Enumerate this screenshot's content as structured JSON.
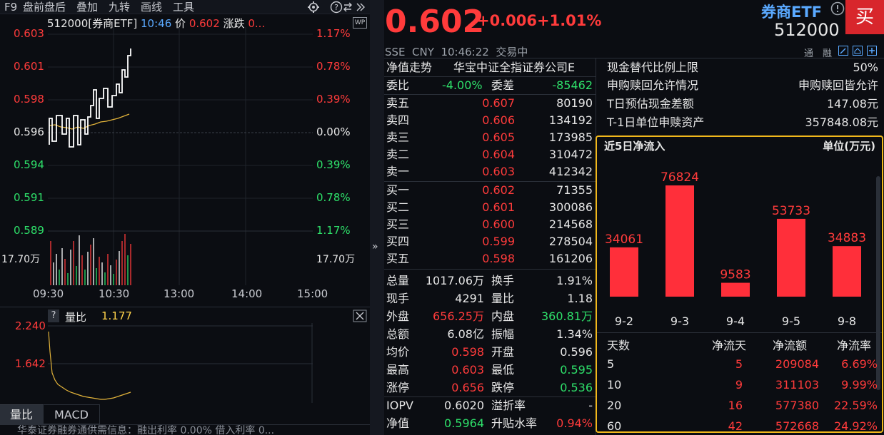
{
  "toolbar": {
    "items": [
      "F9",
      "盘前盘后",
      "叠加",
      "九转",
      "画线",
      "工具"
    ],
    "icons": [
      "gear-icon",
      "help-icon",
      "swap-icon",
      "expand-icon"
    ]
  },
  "chart": {
    "header": {
      "code_name": "512000[券商ETF]",
      "time": "10:46",
      "price_label": "价",
      "price": "0.602",
      "change_label": "涨跌",
      "change_trunc": "0..."
    },
    "wp_badge": "WP",
    "price_levels": [
      "0.603",
      "0.601",
      "0.598",
      "0.596",
      "0.594",
      "0.591",
      "0.589"
    ],
    "pct_levels": [
      "1.17%",
      "0.78%",
      "0.39%",
      "0.00%",
      "0.39%",
      "0.78%",
      "1.17%"
    ],
    "volume_label": "17.70万",
    "volume_label_right": "17.70万",
    "time_axis": [
      "09:30",
      "10:30",
      "13:00",
      "14:00",
      "15:00"
    ],
    "indicator": {
      "help": "?",
      "name": "量比",
      "value": "1.177",
      "levels": [
        "2.240",
        "1.642"
      ]
    },
    "tabs": [
      "量比",
      "MACD"
    ],
    "ticker": "华泰证券融券通供需信息：融出利率 0.00%  借入利率 0..."
  },
  "header": {
    "price": "0.602",
    "change": "+0.006",
    "change_pct": "+1.01%",
    "name": "券商ETF",
    "code": "512000",
    "buy_label": "买",
    "exchange_line": "SSE  CNY  10:46:22  交易中",
    "badges": [
      "通",
      "融"
    ]
  },
  "nav_row": {
    "label": "净值走势",
    "index": "华宝中证全指证券公司E"
  },
  "order_ratio": {
    "label": "委比",
    "value": "-4.00%",
    "diff_label": "委差",
    "diff": "-85462"
  },
  "asks": [
    {
      "label": "卖五",
      "price": "0.607",
      "vol": "80190"
    },
    {
      "label": "卖四",
      "price": "0.606",
      "vol": "134192"
    },
    {
      "label": "卖三",
      "price": "0.605",
      "vol": "173985"
    },
    {
      "label": "卖二",
      "price": "0.604",
      "vol": "310472"
    },
    {
      "label": "卖一",
      "price": "0.603",
      "vol": "412342"
    }
  ],
  "bids": [
    {
      "label": "买一",
      "price": "0.602",
      "vol": "71355"
    },
    {
      "label": "买二",
      "price": "0.601",
      "vol": "300086"
    },
    {
      "label": "买三",
      "price": "0.600",
      "vol": "214568"
    },
    {
      "label": "买四",
      "price": "0.599",
      "vol": "278504"
    },
    {
      "label": "买五",
      "price": "0.598",
      "vol": "161206"
    }
  ],
  "stats": [
    {
      "l1": "总量",
      "v1": "1017.06万",
      "c1": "white",
      "l2": "换手",
      "v2": "1.91%",
      "c2": "white"
    },
    {
      "l1": "现手",
      "v1": "4291",
      "c1": "white",
      "l2": "量比",
      "v2": "1.18",
      "c2": "white"
    },
    {
      "l1": "外盘",
      "v1": "656.25万",
      "c1": "red",
      "l2": "内盘",
      "v2": "360.81万",
      "c2": "green"
    },
    {
      "l1": "总额",
      "v1": "6.08亿",
      "c1": "white",
      "l2": "振幅",
      "v2": "1.34%",
      "c2": "white"
    },
    {
      "l1": "均价",
      "v1": "0.598",
      "c1": "red",
      "l2": "开盘",
      "v2": "0.596",
      "c2": "white"
    },
    {
      "l1": "最高",
      "v1": "0.603",
      "c1": "red",
      "l2": "最低",
      "v2": "0.595",
      "c2": "green"
    },
    {
      "l1": "涨停",
      "v1": "0.656",
      "c1": "red",
      "l2": "跌停",
      "v2": "0.536",
      "c2": "green"
    },
    {
      "l1": "IOPV",
      "v1": "0.6020",
      "c1": "white",
      "l2": "溢折率",
      "v2": "-",
      "c2": "white"
    },
    {
      "l1": "净值",
      "v1": "0.5964",
      "c1": "green",
      "l2": "升贴水率",
      "v2": "0.94%",
      "c2": "red"
    }
  ],
  "etf_info": [
    {
      "label": "现金替代比例上限",
      "value": "50%"
    },
    {
      "label": "申购赎回允许情况",
      "value": "申购赎回皆允许"
    },
    {
      "label": "T日预估现金差额",
      "value": "147.08元"
    },
    {
      "label": "T-1日单位申赎资产",
      "value": "357848.08元"
    }
  ],
  "flow": {
    "title": "近5日净流入",
    "unit": "单位(万元)",
    "table_headers": [
      "天数",
      "净流天",
      "净流额",
      "净流率"
    ],
    "table_rows": [
      {
        "days": "5",
        "net_days": "5",
        "amount": "209084",
        "rate": "6.69%"
      },
      {
        "days": "10",
        "net_days": "9",
        "amount": "311103",
        "rate": "9.99%"
      },
      {
        "days": "20",
        "net_days": "16",
        "amount": "577380",
        "rate": "22.59%"
      },
      {
        "days": "60",
        "net_days": "42",
        "amount": "572668",
        "rate": "24.92%"
      }
    ]
  },
  "chart_data": {
    "type": "bar",
    "categories": [
      "9-2",
      "9-3",
      "9-4",
      "9-5",
      "9-8"
    ],
    "values": [
      34061,
      76824,
      9583,
      53733,
      34883
    ],
    "title": "近5日净流入",
    "unit": "单位(万元)",
    "bar_color": "#ff2f3a",
    "ylim": [
      0,
      76824
    ]
  },
  "colors": {
    "up": "#ff3b3b",
    "down": "#2ee06a",
    "highlight": "#f1b81c",
    "buy": "#d8262c",
    "name": "#5aa9ff"
  }
}
